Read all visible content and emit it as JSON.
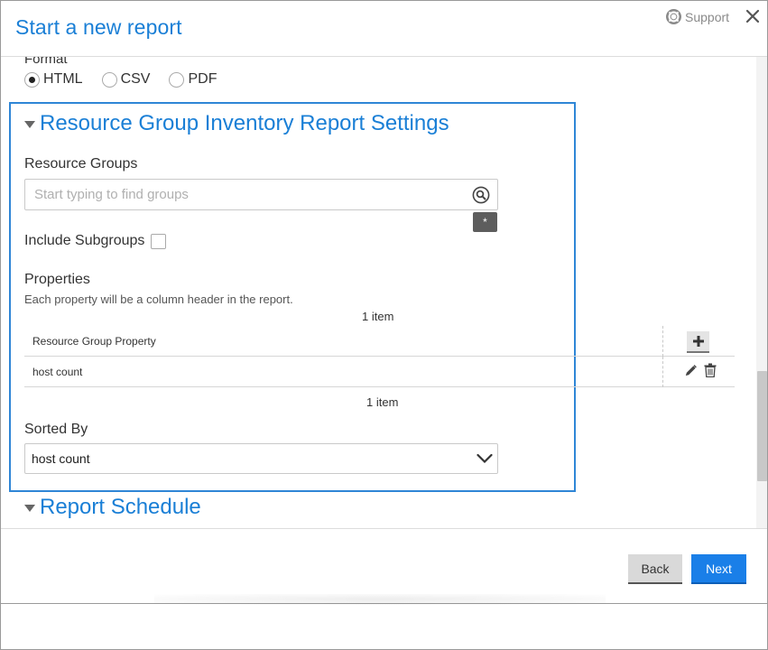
{
  "dialog": {
    "title": "Start a new report",
    "support_label": "Support"
  },
  "format": {
    "label": "Format",
    "options": [
      "HTML",
      "CSV",
      "PDF"
    ],
    "selected": "HTML"
  },
  "settings_section": {
    "title": "Resource Group Inventory Report Settings",
    "resource_groups": {
      "label": "Resource Groups",
      "placeholder": "Start typing to find groups",
      "badge": "*"
    },
    "include_subgroups": {
      "label": "Include Subgroups",
      "checked": false
    },
    "properties": {
      "label": "Properties",
      "description": "Each property will be a column header in the report.",
      "count_top": "1 item",
      "count_bottom": "1 item",
      "column_header": "Resource Group Property",
      "rows": [
        {
          "name": "host count"
        }
      ]
    },
    "sorted_by": {
      "label": "Sorted By",
      "value": "host count"
    }
  },
  "schedule_section": {
    "title": "Report Schedule"
  },
  "footer": {
    "back_label": "Back",
    "next_label": "Next"
  },
  "colors": {
    "accent": "#1a7fd6",
    "primary_button": "#1a7fe8",
    "section_border": "#2f86d6"
  },
  "icons": [
    "support-lifebuoy-icon",
    "close-icon",
    "search-icon",
    "chevron-down-icon",
    "plus-icon",
    "pencil-icon",
    "trash-icon",
    "triangle-down-icon"
  ]
}
